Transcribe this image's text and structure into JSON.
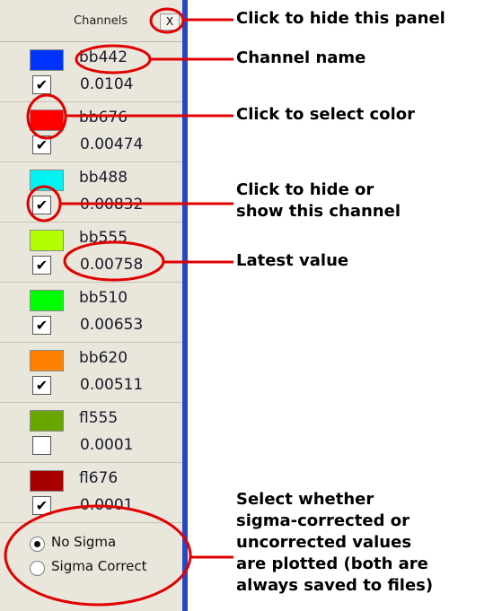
{
  "panel": {
    "header": {
      "title": "Channels",
      "close_label": "X"
    },
    "channels": [
      {
        "name": "bb442",
        "value": "0.0104",
        "color": "#0033ff",
        "checked": true
      },
      {
        "name": "bb676",
        "value": "0.00474",
        "color": "#ff0000",
        "checked": true
      },
      {
        "name": "bb488",
        "value": "0.00832",
        "color": "#00f3f3",
        "checked": true
      },
      {
        "name": "bb555",
        "value": "0.00758",
        "color": "#b3ff00",
        "checked": true
      },
      {
        "name": "bb510",
        "value": "0.00653",
        "color": "#00ff00",
        "checked": true
      },
      {
        "name": "bb620",
        "value": "0.00511",
        "color": "#ff8000",
        "checked": true
      },
      {
        "name": "fl555",
        "value": "0.0001",
        "color": "#6aa600",
        "checked": false
      },
      {
        "name": "fl676",
        "value": "0.0001",
        "color": "#a80000",
        "checked": true
      }
    ],
    "sigma": {
      "options": [
        "No Sigma",
        "Sigma Correct"
      ],
      "selected": "No Sigma"
    },
    "check_glyph": "✔"
  },
  "annotations": {
    "hide_panel": "Click to hide this panel",
    "channel_name": "Channel name",
    "select_color": "Click to select color",
    "hide_show_1": "Click to hide or",
    "hide_show_2": "show this channel",
    "latest_value": "Latest value",
    "sigma_1": "Select whether",
    "sigma_2": "sigma-corrected or",
    "sigma_3": "uncorrected values",
    "sigma_4": "are plotted (both are",
    "sigma_5": "always saved to files)"
  },
  "colors": {
    "annotation_red": "#e00000",
    "panel_bg": "#e9e6dc",
    "panel_edge": "#2847c4"
  }
}
